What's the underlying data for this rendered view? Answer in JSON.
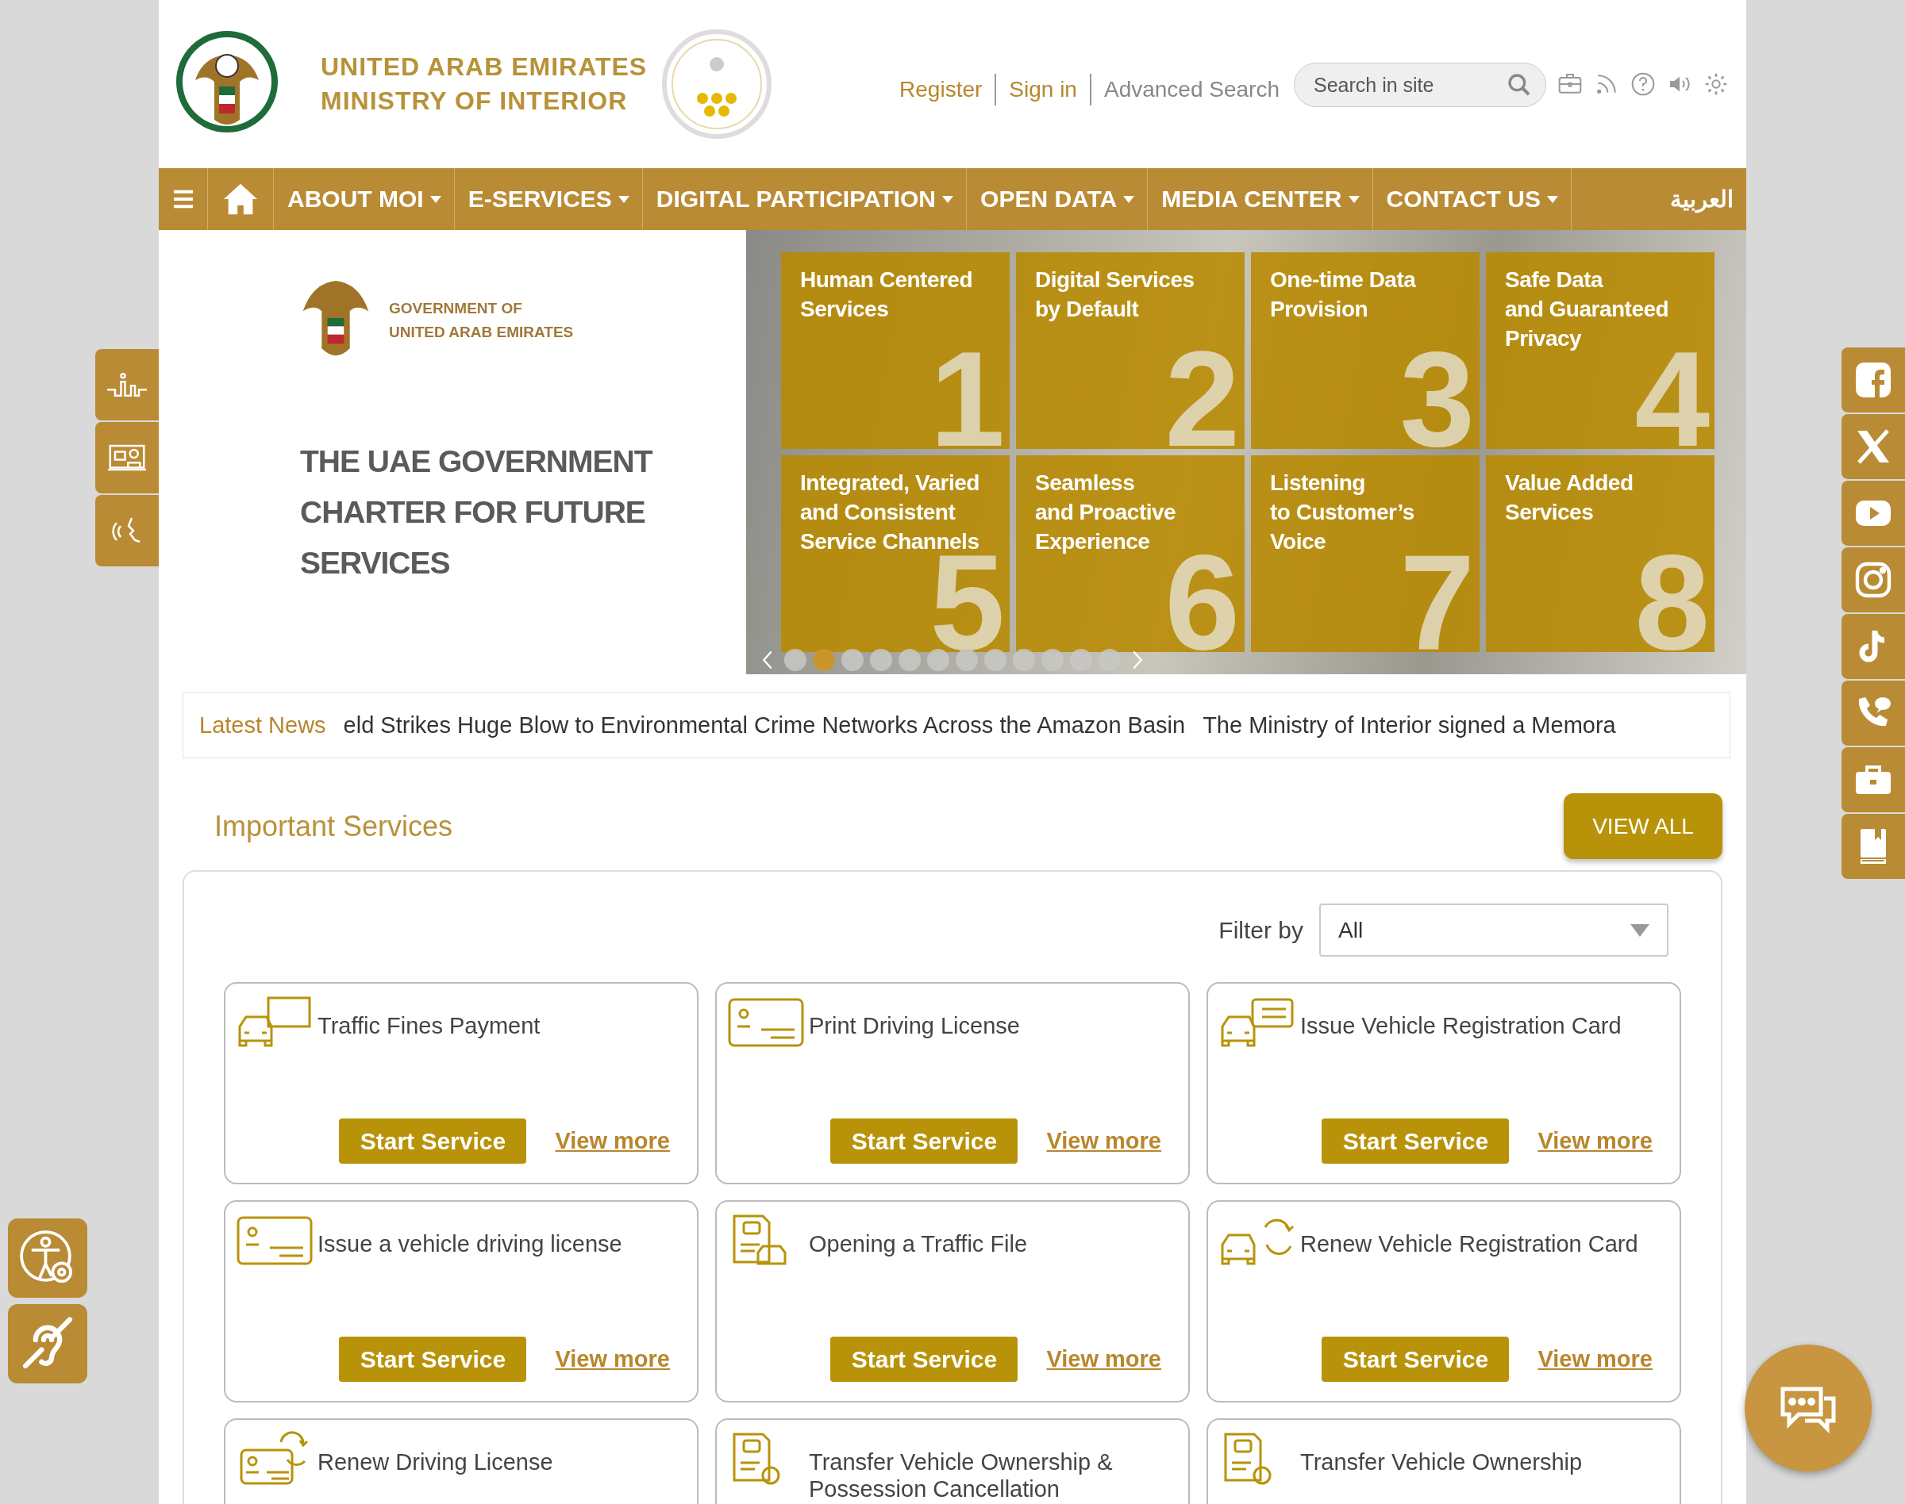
{
  "header": {
    "logo_line1": "UNITED ARAB EMIRATES",
    "logo_line2": "MINISTRY OF INTERIOR",
    "links": [
      "Register",
      "Sign in",
      "Advanced Search"
    ],
    "search": {
      "placeholder": "Search in site"
    }
  },
  "nav": {
    "items": [
      {
        "label": "ABOUT MOI",
        "dropdown": true
      },
      {
        "label": "E-SERVICES",
        "dropdown": true
      },
      {
        "label": "DIGITAL PARTICIPATION",
        "dropdown": true
      },
      {
        "label": "OPEN DATA",
        "dropdown": true
      },
      {
        "label": "MEDIA CENTER",
        "dropdown": true
      },
      {
        "label": "CONTACT US",
        "dropdown": true
      }
    ],
    "language": "العربية"
  },
  "banner": {
    "gov_line1": "GOVERNMENT OF",
    "gov_line2": "UNITED ARAB EMIRATES",
    "heading_lines": [
      "THE UAE GOVERNMENT",
      "CHARTER FOR FUTURE",
      "SERVICES"
    ],
    "tiles": [
      {
        "title_lines": [
          "Human Centered",
          "Services"
        ],
        "number": "1"
      },
      {
        "title_lines": [
          "Digital Services",
          "by Default"
        ],
        "number": "2"
      },
      {
        "title_lines": [
          "One-time Data",
          "Provision"
        ],
        "number": "3"
      },
      {
        "title_lines": [
          "Safe Data",
          "and Guaranteed",
          "Privacy"
        ],
        "number": "4"
      },
      {
        "title_lines": [
          "Integrated, Varied",
          "and Consistent",
          "Service Channels"
        ],
        "number": "5"
      },
      {
        "title_lines": [
          "Seamless",
          "and Proactive",
          "Experience"
        ],
        "number": "6"
      },
      {
        "title_lines": [
          "Listening",
          "to Customer’s",
          "Voice"
        ],
        "number": "7"
      },
      {
        "title_lines": [
          "Value Added",
          "Services"
        ],
        "number": "8"
      }
    ],
    "dots": [
      {
        "selected": false
      },
      {
        "selected": true
      },
      {
        "selected": false
      },
      {
        "selected": false
      },
      {
        "selected": false
      },
      {
        "selected": false
      },
      {
        "selected": false
      },
      {
        "selected": false
      },
      {
        "selected": false
      },
      {
        "selected": false
      },
      {
        "selected": false
      },
      {
        "selected": false
      }
    ]
  },
  "news": {
    "label": "Latest News",
    "items": [
      "eld Strikes Huge Blow to Environmental Crime Networks Across the Amazon Basin",
      "The Ministry of Interior signed a Memora"
    ]
  },
  "services": {
    "title": "Important Services",
    "view_all": "VIEW ALL",
    "filter_label": "Filter by",
    "filter_value": "All",
    "cards": [
      {
        "title": "Traffic Fines Payment",
        "kind": "fines",
        "start": "Start Service",
        "more": "View more"
      },
      {
        "title": "Print Driving License",
        "kind": "license",
        "start": "Start Service",
        "more": "View more"
      },
      {
        "title": "Issue Vehicle Registration Card",
        "kind": "vehicle-card",
        "start": "Start Service",
        "more": "View more"
      },
      {
        "title": "Issue a vehicle driving license",
        "kind": "license",
        "start": "Start Service",
        "more": "View more"
      },
      {
        "title": "Opening a Traffic File",
        "kind": "file",
        "start": "Start Service",
        "more": "View more"
      },
      {
        "title": "Renew Vehicle Registration Card",
        "kind": "renew-vehicle",
        "start": "Start Service",
        "more": "View more"
      },
      {
        "title": "Renew Driving License",
        "kind": "renew-license"
      },
      {
        "title": "Transfer Vehicle Ownership & Possession Cancellation",
        "kind": "transfer"
      },
      {
        "title": "Transfer Vehicle Ownership",
        "kind": "transfer"
      }
    ]
  }
}
